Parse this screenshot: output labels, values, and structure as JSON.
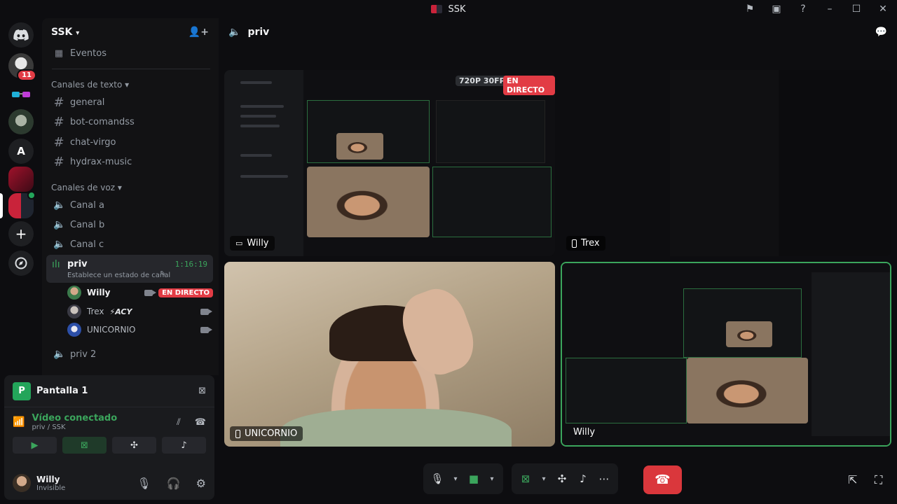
{
  "window": {
    "title": "SSK"
  },
  "server": {
    "name": "SSK",
    "unread_badge": "11"
  },
  "sidebar": {
    "events_label": "Eventos",
    "text_category": "Canales de texto",
    "text_channels": [
      "general",
      "bot-comandss",
      "chat-virgo",
      "hydrax-music"
    ],
    "voice_category": "Canales de voz",
    "voice_channels": [
      "Canal a",
      "Canal b",
      "Canal c"
    ],
    "active_channel": {
      "name": "priv",
      "timer": "1:16:19",
      "status_placeholder": "Establece un estado de canal"
    },
    "voice_users": [
      {
        "name": "Willy",
        "badge": "EN DIRECTO"
      },
      {
        "name": "Trex",
        "tag": "⚡ACY"
      },
      {
        "name": "UNICORNIO"
      }
    ],
    "other_channel": "priv 2"
  },
  "panel": {
    "screen_title": "Pantalla 1",
    "screen_icon_letter": "P",
    "connection_status": "Vídeo conectado",
    "connection_location": "priv / SSK",
    "user_name": "Willy",
    "user_status": "Invisible"
  },
  "main": {
    "channel_name": "priv",
    "tiles": {
      "willy_stream": {
        "label": "Willy",
        "quality_tag": "720P 30FPS",
        "live_tag": "EN DIRECTO"
      },
      "trex": {
        "label": "Trex"
      },
      "unicornio": {
        "label": "UNICORNIO"
      },
      "willy_screen": {
        "label": "Willy"
      }
    }
  },
  "colors": {
    "accent_green": "#3ba55c",
    "live_red": "#e23c45",
    "end_call_red": "#da373c",
    "server_rail_bg": "#0d0d10",
    "sidebar_bg": "#121214"
  }
}
